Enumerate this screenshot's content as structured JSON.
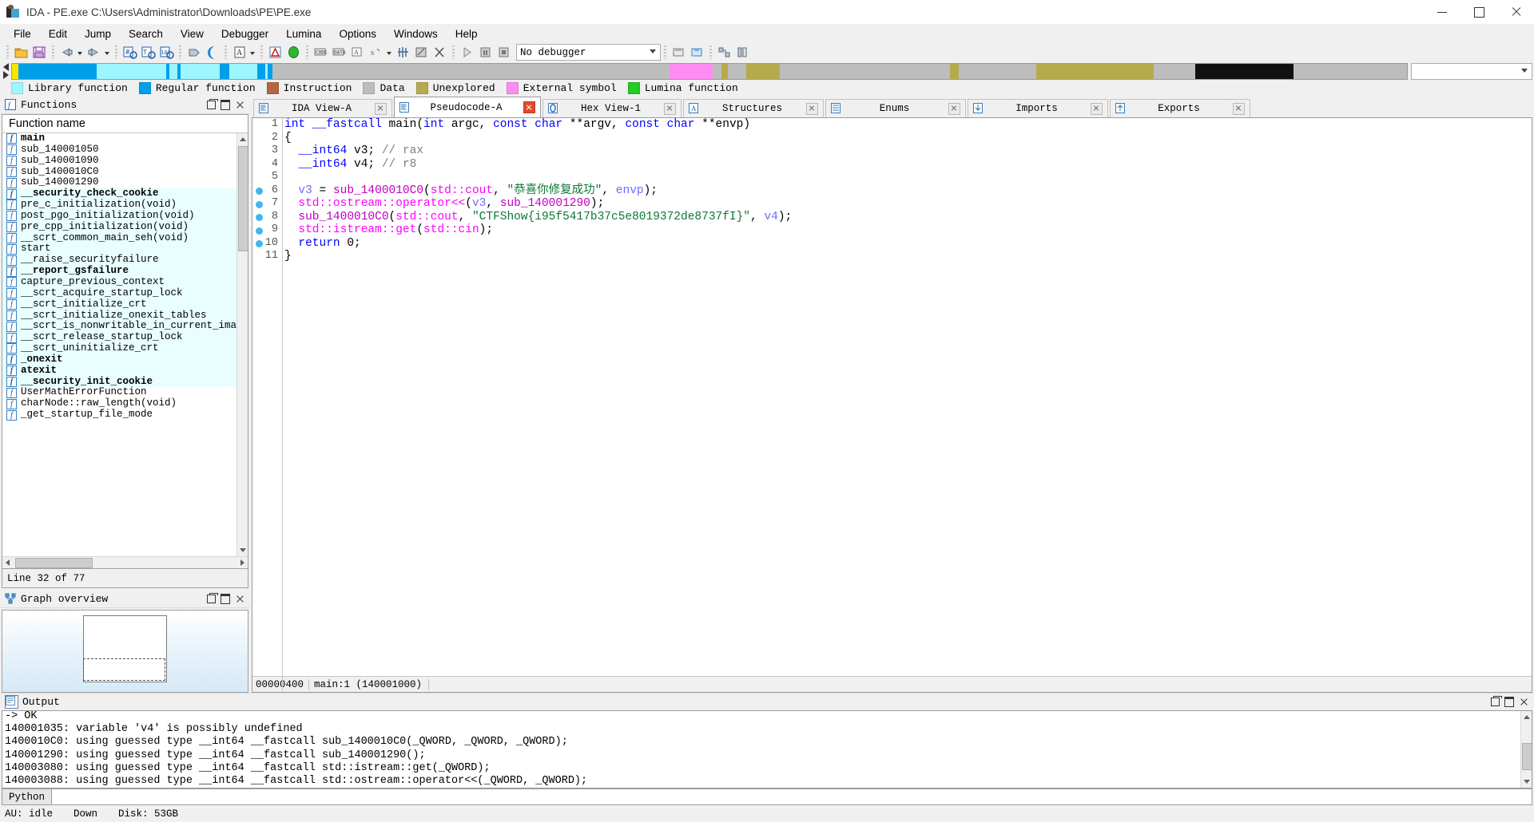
{
  "window": {
    "title": "IDA - PE.exe C:\\Users\\Administrator\\Downloads\\PE\\PE.exe",
    "app_icon": "ida-logo-icon",
    "minimize": "–",
    "maximize": "□",
    "close": "✕"
  },
  "menu": [
    {
      "label": "File"
    },
    {
      "label": "Edit"
    },
    {
      "label": "Jump"
    },
    {
      "label": "Search"
    },
    {
      "label": "View"
    },
    {
      "label": "Debugger"
    },
    {
      "label": "Lumina"
    },
    {
      "label": "Options"
    },
    {
      "label": "Windows"
    },
    {
      "label": "Help"
    }
  ],
  "toolbar": {
    "debugger_select_value": "No debugger",
    "icons": [
      "open-file-icon",
      "save-icon",
      "back-icon",
      "back-dropdown-icon",
      "forward-icon",
      "forward-dropdown-icon",
      "jump-to-address-icon",
      "text-search-icon",
      "binary-search-icon",
      "search-again-icon",
      "moon-icon",
      "ascii-string-icon",
      "ascii-dropdown-icon",
      "alerts-icon",
      "lumina-icon",
      "make-code-icon",
      "make-data-icon",
      "make-array-icon",
      "undefine-icon",
      "undefine-dropdown-icon",
      "make-struct-icon",
      "edit-function-icon",
      "delete-function-icon",
      "run-icon",
      "pause-icon",
      "stop-icon"
    ]
  },
  "navband": {
    "segments": [
      {
        "color": "#f7e600",
        "width_pct": 0.45
      },
      {
        "color": "#00a0e9",
        "width_pct": 5.6
      },
      {
        "color": "#9cf5ff",
        "width_pct": 5.0
      },
      {
        "color": "#00a0e9",
        "width_pct": 0.25
      },
      {
        "color": "#9cf5ff",
        "width_pct": 0.55
      },
      {
        "color": "#00a0e9",
        "width_pct": 0.25
      },
      {
        "color": "#9cf5ff",
        "width_pct": 2.8
      },
      {
        "color": "#00a0e9",
        "width_pct": 0.7
      },
      {
        "color": "#9cf5ff",
        "width_pct": 2.0
      },
      {
        "color": "#00a0e9",
        "width_pct": 0.55
      },
      {
        "color": "#9cf5ff",
        "width_pct": 0.2
      },
      {
        "color": "#00a0e9",
        "width_pct": 0.3
      },
      {
        "color": "#bdbdbd",
        "width_pct": 28.5
      },
      {
        "color": "#ff8cf0",
        "width_pct": 3.1
      },
      {
        "color": "#bdbdbd",
        "width_pct": 0.6
      },
      {
        "color": "#b5ab4e",
        "width_pct": 0.5
      },
      {
        "color": "#bdbdbd",
        "width_pct": 1.3
      },
      {
        "color": "#b5ab4e",
        "width_pct": 2.4
      },
      {
        "color": "#bdbdbd",
        "width_pct": 12.2
      },
      {
        "color": "#b5ab4e",
        "width_pct": 0.6
      },
      {
        "color": "#bdbdbd",
        "width_pct": 5.6
      },
      {
        "color": "#b5ab4e",
        "width_pct": 8.4
      },
      {
        "color": "#bdbdbd",
        "width_pct": 3.0
      },
      {
        "color": "#111111",
        "width_pct": 7.0
      },
      {
        "color": "#bdbdbd",
        "width_pct": 8.0
      }
    ]
  },
  "legend": [
    {
      "label": "Library function",
      "color": "#9cf5ff",
      "name": "library-function"
    },
    {
      "label": "Regular function",
      "color": "#00a0e9",
      "name": "regular-function"
    },
    {
      "label": "Instruction",
      "color": "#b5653f",
      "name": "instruction"
    },
    {
      "label": "Data",
      "color": "#bdbdbd",
      "name": "data"
    },
    {
      "label": "Unexplored",
      "color": "#b5ab4e",
      "name": "unexplored"
    },
    {
      "label": "External symbol",
      "color": "#ff8cf0",
      "name": "external-symbol"
    },
    {
      "label": "Lumina function",
      "color": "#22cc22",
      "name": "lumina-function"
    }
  ],
  "functions_panel": {
    "title": "Functions",
    "icon": "functions-icon",
    "column_header": "Function name",
    "status": "Line 32 of 77",
    "items": [
      {
        "name": "main",
        "bold": true,
        "lib": false
      },
      {
        "name": "sub_140001050",
        "bold": false,
        "lib": false
      },
      {
        "name": "sub_140001090",
        "bold": false,
        "lib": false
      },
      {
        "name": "sub_1400010C0",
        "bold": false,
        "lib": false
      },
      {
        "name": "sub_140001290",
        "bold": false,
        "lib": false
      },
      {
        "name": "__security_check_cookie",
        "bold": true,
        "lib": true
      },
      {
        "name": "pre_c_initialization(void)",
        "bold": false,
        "lib": true
      },
      {
        "name": "post_pgo_initialization(void)",
        "bold": false,
        "lib": true
      },
      {
        "name": "pre_cpp_initialization(void)",
        "bold": false,
        "lib": true
      },
      {
        "name": "__scrt_common_main_seh(void)",
        "bold": false,
        "lib": true
      },
      {
        "name": "start",
        "bold": false,
        "lib": true
      },
      {
        "name": "__raise_securityfailure",
        "bold": false,
        "lib": true
      },
      {
        "name": "__report_gsfailure",
        "bold": true,
        "lib": true
      },
      {
        "name": "capture_previous_context",
        "bold": false,
        "lib": true
      },
      {
        "name": "__scrt_acquire_startup_lock",
        "bold": false,
        "lib": true
      },
      {
        "name": "__scrt_initialize_crt",
        "bold": false,
        "lib": true
      },
      {
        "name": "__scrt_initialize_onexit_tables",
        "bold": false,
        "lib": true
      },
      {
        "name": "__scrt_is_nonwritable_in_current_image",
        "bold": false,
        "lib": true
      },
      {
        "name": "__scrt_release_startup_lock",
        "bold": false,
        "lib": true
      },
      {
        "name": "__scrt_uninitialize_crt",
        "bold": false,
        "lib": true
      },
      {
        "name": "_onexit",
        "bold": true,
        "lib": true
      },
      {
        "name": "atexit",
        "bold": true,
        "lib": true
      },
      {
        "name": "__security_init_cookie",
        "bold": true,
        "lib": true
      },
      {
        "name": "UserMathErrorFunction",
        "bold": false,
        "lib": false
      },
      {
        "name": "charNode::raw_length(void)",
        "bold": false,
        "lib": false
      },
      {
        "name": "_get_startup_file_mode",
        "bold": false,
        "lib": false
      }
    ]
  },
  "graph_overview": {
    "title": "Graph overview",
    "icon": "graph-overview-icon"
  },
  "tabs": [
    {
      "label": "IDA View-A",
      "icon": "ida-view-icon",
      "active": false
    },
    {
      "label": "Pseudocode-A",
      "icon": "pseudocode-icon",
      "active": true
    },
    {
      "label": "Hex View-1",
      "icon": "hex-view-icon",
      "active": false
    },
    {
      "label": "Structures",
      "icon": "structures-icon",
      "active": false
    },
    {
      "label": "Enums",
      "icon": "enums-icon",
      "active": false
    },
    {
      "label": "Imports",
      "icon": "imports-icon",
      "active": false
    },
    {
      "label": "Exports",
      "icon": "exports-icon",
      "active": false
    }
  ],
  "pseudocode": {
    "status": {
      "offset": "00000400",
      "location": "main:1",
      "address": "(140001000)"
    },
    "lines": [
      {
        "n": "1",
        "bp": false,
        "tokens": [
          {
            "t": "int ",
            "c": "t-kw"
          },
          {
            "t": "__fastcall ",
            "c": "t-kw"
          },
          {
            "t": "main(",
            "c": "t-plain"
          },
          {
            "t": "int ",
            "c": "t-kw"
          },
          {
            "t": "argc, ",
            "c": "t-plain"
          },
          {
            "t": "const char ",
            "c": "t-kw"
          },
          {
            "t": "**argv, ",
            "c": "t-plain"
          },
          {
            "t": "const char ",
            "c": "t-kw"
          },
          {
            "t": "**envp)",
            "c": "t-plain"
          }
        ]
      },
      {
        "n": "2",
        "bp": false,
        "tokens": [
          {
            "t": "{",
            "c": "t-plain"
          }
        ]
      },
      {
        "n": "3",
        "bp": false,
        "tokens": [
          {
            "t": "  __int64",
            "c": "t-kw"
          },
          {
            "t": " v3; ",
            "c": "t-plain"
          },
          {
            "t": "// rax",
            "c": "t-cmt"
          }
        ]
      },
      {
        "n": "4",
        "bp": false,
        "tokens": [
          {
            "t": "  __int64",
            "c": "t-kw"
          },
          {
            "t": " v4; ",
            "c": "t-plain"
          },
          {
            "t": "// r8",
            "c": "t-cmt"
          }
        ]
      },
      {
        "n": "5",
        "bp": false,
        "tokens": [
          {
            "t": "",
            "c": "t-plain"
          }
        ]
      },
      {
        "n": "6",
        "bp": true,
        "tokens": [
          {
            "t": "  ",
            "c": "t-plain"
          },
          {
            "t": "v3",
            "c": "t-var"
          },
          {
            "t": " = ",
            "c": "t-plain"
          },
          {
            "t": "sub_1400010C0",
            "c": "t-fn"
          },
          {
            "t": "(",
            "c": "t-plain"
          },
          {
            "t": "std::cout",
            "c": "t-ns"
          },
          {
            "t": ", ",
            "c": "t-plain"
          },
          {
            "t": "\"恭喜你修复成功\"",
            "c": "t-str"
          },
          {
            "t": ", ",
            "c": "t-plain"
          },
          {
            "t": "envp",
            "c": "t-var"
          },
          {
            "t": ");",
            "c": "t-plain"
          }
        ]
      },
      {
        "n": "7",
        "bp": true,
        "tokens": [
          {
            "t": "  ",
            "c": "t-plain"
          },
          {
            "t": "std::ostream::operator<<",
            "c": "t-ns"
          },
          {
            "t": "(",
            "c": "t-plain"
          },
          {
            "t": "v3",
            "c": "t-var"
          },
          {
            "t": ", ",
            "c": "t-plain"
          },
          {
            "t": "sub_140001290",
            "c": "t-fn"
          },
          {
            "t": ");",
            "c": "t-plain"
          }
        ]
      },
      {
        "n": "8",
        "bp": true,
        "tokens": [
          {
            "t": "  ",
            "c": "t-plain"
          },
          {
            "t": "sub_1400010C0",
            "c": "t-fn"
          },
          {
            "t": "(",
            "c": "t-plain"
          },
          {
            "t": "std::cout",
            "c": "t-ns"
          },
          {
            "t": ", ",
            "c": "t-plain"
          },
          {
            "t": "\"CTFShow{i95f5417b37c5e8019372de8737fI}\"",
            "c": "t-str"
          },
          {
            "t": ", ",
            "c": "t-plain"
          },
          {
            "t": "v4",
            "c": "t-var"
          },
          {
            "t": ");",
            "c": "t-plain"
          }
        ]
      },
      {
        "n": "9",
        "bp": true,
        "tokens": [
          {
            "t": "  ",
            "c": "t-plain"
          },
          {
            "t": "std::istream::get",
            "c": "t-ns"
          },
          {
            "t": "(",
            "c": "t-plain"
          },
          {
            "t": "std::cin",
            "c": "t-ns"
          },
          {
            "t": ");",
            "c": "t-plain"
          }
        ]
      },
      {
        "n": "10",
        "bp": true,
        "tokens": [
          {
            "t": "  ",
            "c": "t-plain"
          },
          {
            "t": "return ",
            "c": "t-kw"
          },
          {
            "t": "0;",
            "c": "t-plain"
          }
        ]
      },
      {
        "n": "11",
        "bp": false,
        "tokens": [
          {
            "t": "}",
            "c": "t-plain"
          }
        ]
      }
    ]
  },
  "output": {
    "title": "Output",
    "icon": "output-icon",
    "lines": [
      "-> OK",
      "140001035: variable 'v4' is possibly undefined",
      "1400010C0: using guessed type __int64 __fastcall sub_1400010C0(_QWORD, _QWORD, _QWORD);",
      "140001290: using guessed type __int64 __fastcall sub_140001290();",
      "140003080: using guessed type __int64 __fastcall std::istream::get(_QWORD);",
      "140003088: using guessed type __int64 __fastcall std::ostream::operator<<(_QWORD, _QWORD);"
    ]
  },
  "python_bar": {
    "button_label": "Python",
    "input_value": ""
  },
  "statusbar": {
    "au": "AU: idle",
    "down": "Down",
    "disk": "Disk: 53GB"
  }
}
